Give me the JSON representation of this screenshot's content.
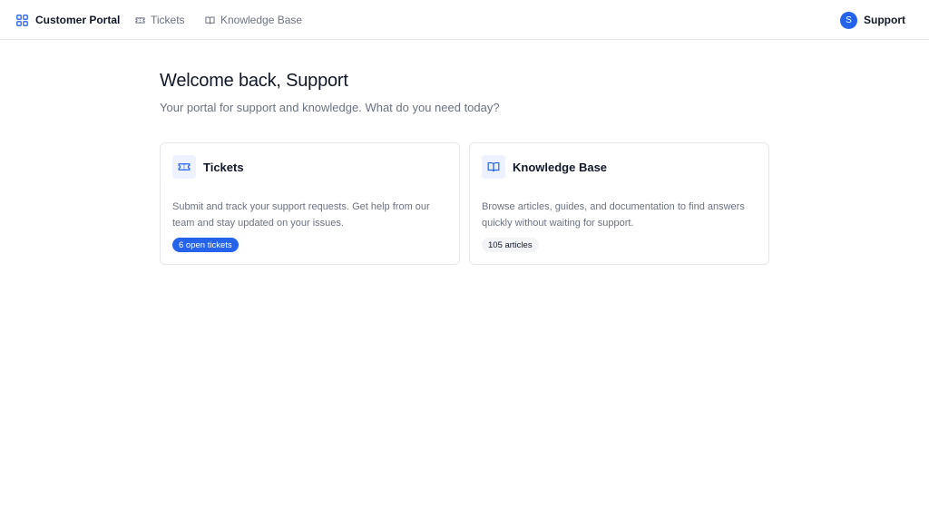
{
  "topbar": {
    "brand": "Customer Portal",
    "nav": [
      {
        "label": "Tickets",
        "icon": "ticket-icon"
      },
      {
        "label": "Knowledge Base",
        "icon": "book-icon"
      }
    ],
    "user": {
      "initial": "S",
      "name": "Support"
    }
  },
  "main": {
    "title": "Welcome back, Support",
    "subtitle": "Your portal for support and knowledge. What do you need today?"
  },
  "cards": [
    {
      "title": "Tickets",
      "icon": "ticket-icon",
      "description": "Submit and track your support requests. Get help from our team and stay updated on your issues.",
      "badge": "6 open tickets"
    },
    {
      "title": "Knowledge Base",
      "icon": "book-icon",
      "description": "Browse articles, guides, and documentation to find answers quickly without waiting for support.",
      "badge": "105 articles"
    }
  ],
  "colors": {
    "accent": "#2563eb",
    "text": "#111827",
    "muted": "#6b7280",
    "border": "#e5e7eb"
  }
}
